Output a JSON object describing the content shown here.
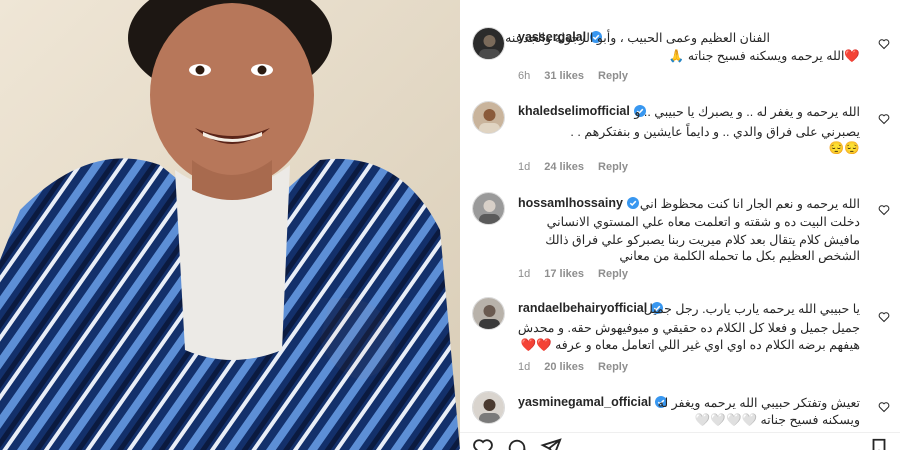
{
  "comments": [
    {
      "username": "yassergalal",
      "lines": [
        "الفنان العظيم وعمى الحبيب ، وأبو الرجولة والجدعنه",
        "❤️الله يرحمه ويسكنه فسيح جناته 🙏"
      ],
      "time": "6h",
      "likes": "31 likes",
      "reply": "Reply",
      "avatar_icon": "avatar-dark-icon"
    },
    {
      "username": "khaledselimofficial",
      "lines": [
        "الله يرحمه و يغفر له .. و يصبرك يا حبيبي .. و",
        "يصبرني على فراق والدي .. و دايماً عايشين و بنفتكرهم . .",
        "😔😔"
      ],
      "time": "1d",
      "likes": "24 likes",
      "reply": "Reply",
      "avatar_icon": "avatar-light-icon"
    },
    {
      "username": "hossamlhossainy",
      "lines": [
        "الله يرحمه و نعم الجار انا كنت محظوظ اني",
        "دخلت البيت ده و شقته و اتعلمت معاه علي المستوي الانساني",
        "مافيش كلام يتقال بعد كلام ميريت ربنا يصبركو علي فراق ذالك",
        "الشخص العظيم بكل ما تحمله الكلمة من معاني"
      ],
      "time": "1d",
      "likes": "17 likes",
      "reply": "Reply",
      "avatar_icon": "avatar-gray-icon"
    },
    {
      "username": "randaelbehairyofficial",
      "lines": [
        "يا حبيبي الله يرحمه يارب يارب. رجل جميل",
        "جميل جميل و فعلا كل الكلام ده حقيقي و ميوفيهوش حقه. و محدش",
        "هيفهم برضه الكلام ده اوي اوي غير اللي اتعامل معاه و عرفه ❤️❤️"
      ],
      "time": "1d",
      "likes": "20 likes",
      "reply": "Reply",
      "avatar_icon": "avatar-woman-icon"
    },
    {
      "username": "yasminegamal_official",
      "lines": [
        "تعيش وتفتكر حبيبي الله يرحمه ويغفر له",
        "ويسكنه فسيح جناته 🤍🤍🤍🤍"
      ],
      "time": "",
      "likes": "",
      "reply": "",
      "avatar_icon": "avatar-woman2-icon"
    }
  ],
  "actions": {
    "like_icon": "heart-outline-icon",
    "comment_icon": "comment-icon",
    "share_icon": "send-icon",
    "save_icon": "bookmark-icon"
  },
  "colors": {
    "text": "#262626",
    "muted": "#8e8e8e",
    "verified": "#3897f0",
    "heart_red": "#ed4956"
  }
}
